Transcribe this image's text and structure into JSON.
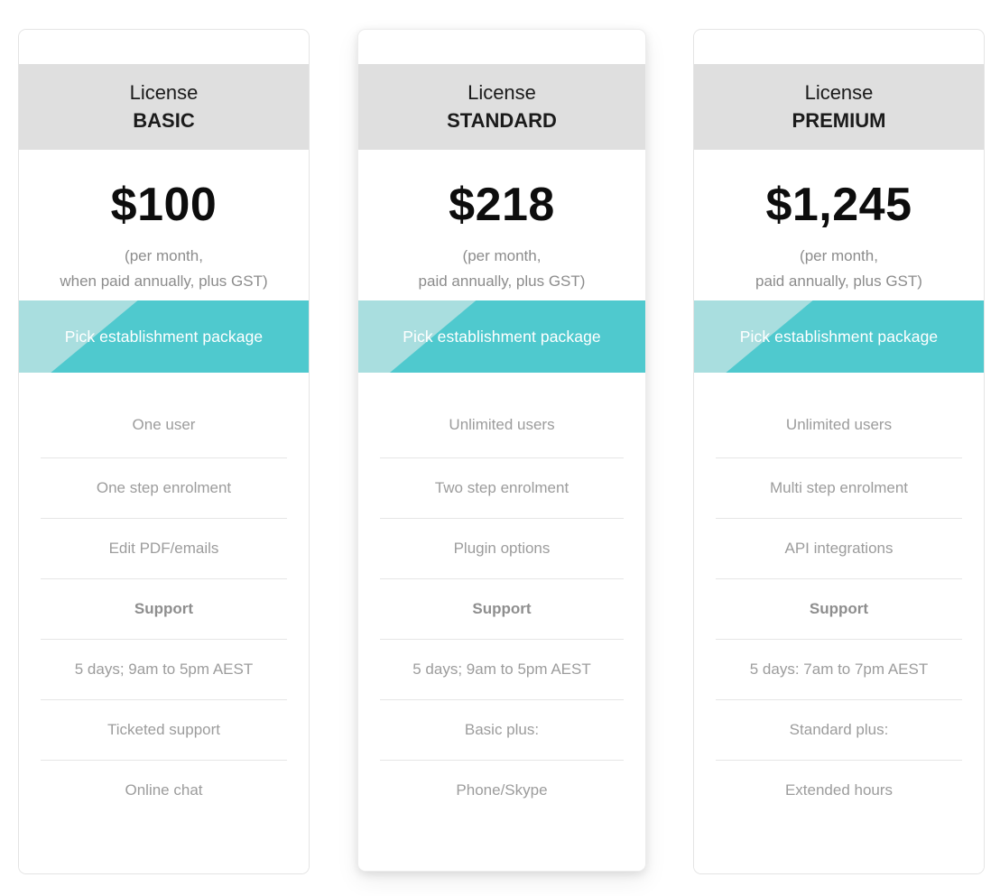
{
  "colors": {
    "header_bg": "#dfdfdf",
    "cta_dark": "#4fc9ce",
    "cta_light": "#a9dedf",
    "price_text": "#0d0d0d",
    "feature_text": "#9c9c9c",
    "divider": "#e6e6e6",
    "card_bg": "#ffffff",
    "page_bg": "#ffffff"
  },
  "plans": [
    {
      "header_line1": "License",
      "header_line2": "BASIC",
      "price": "$100",
      "price_note_line1": "(per month,",
      "price_note_line2": "when paid annually, plus GST)",
      "cta_label": "Pick establishment package",
      "features": [
        {
          "label": "One user",
          "bold": false
        },
        {
          "label": "One step enrolment",
          "bold": false
        },
        {
          "label": "Edit PDF/emails",
          "bold": false
        },
        {
          "label": "Support",
          "bold": true
        },
        {
          "label": "5 days; 9am to 5pm AEST",
          "bold": false
        },
        {
          "label": "Ticketed support",
          "bold": false
        },
        {
          "label": "Online chat",
          "bold": false
        }
      ]
    },
    {
      "header_line1": "License",
      "header_line2": "STANDARD",
      "price": "$218",
      "price_note_line1": "(per month,",
      "price_note_line2": "paid annually, plus GST)",
      "cta_label": "Pick establishment package",
      "features": [
        {
          "label": "Unlimited users",
          "bold": false
        },
        {
          "label": "Two step enrolment",
          "bold": false
        },
        {
          "label": "Plugin options",
          "bold": false
        },
        {
          "label": "Support",
          "bold": true
        },
        {
          "label": "5 days; 9am to 5pm AEST",
          "bold": false
        },
        {
          "label": "Basic plus:",
          "bold": false
        },
        {
          "label": "Phone/Skype",
          "bold": false
        }
      ]
    },
    {
      "header_line1": "License",
      "header_line2": "PREMIUM",
      "price": "$1,245",
      "price_note_line1": "(per month,",
      "price_note_line2": "paid annually, plus GST)",
      "cta_label": "Pick establishment package",
      "features": [
        {
          "label": "Unlimited users",
          "bold": false
        },
        {
          "label": "Multi step enrolment",
          "bold": false
        },
        {
          "label": "API integrations",
          "bold": false
        },
        {
          "label": "Support",
          "bold": true
        },
        {
          "label": "5 days: 7am to 7pm AEST",
          "bold": false
        },
        {
          "label": "Standard plus:",
          "bold": false
        },
        {
          "label": "Extended hours",
          "bold": false
        }
      ]
    }
  ]
}
